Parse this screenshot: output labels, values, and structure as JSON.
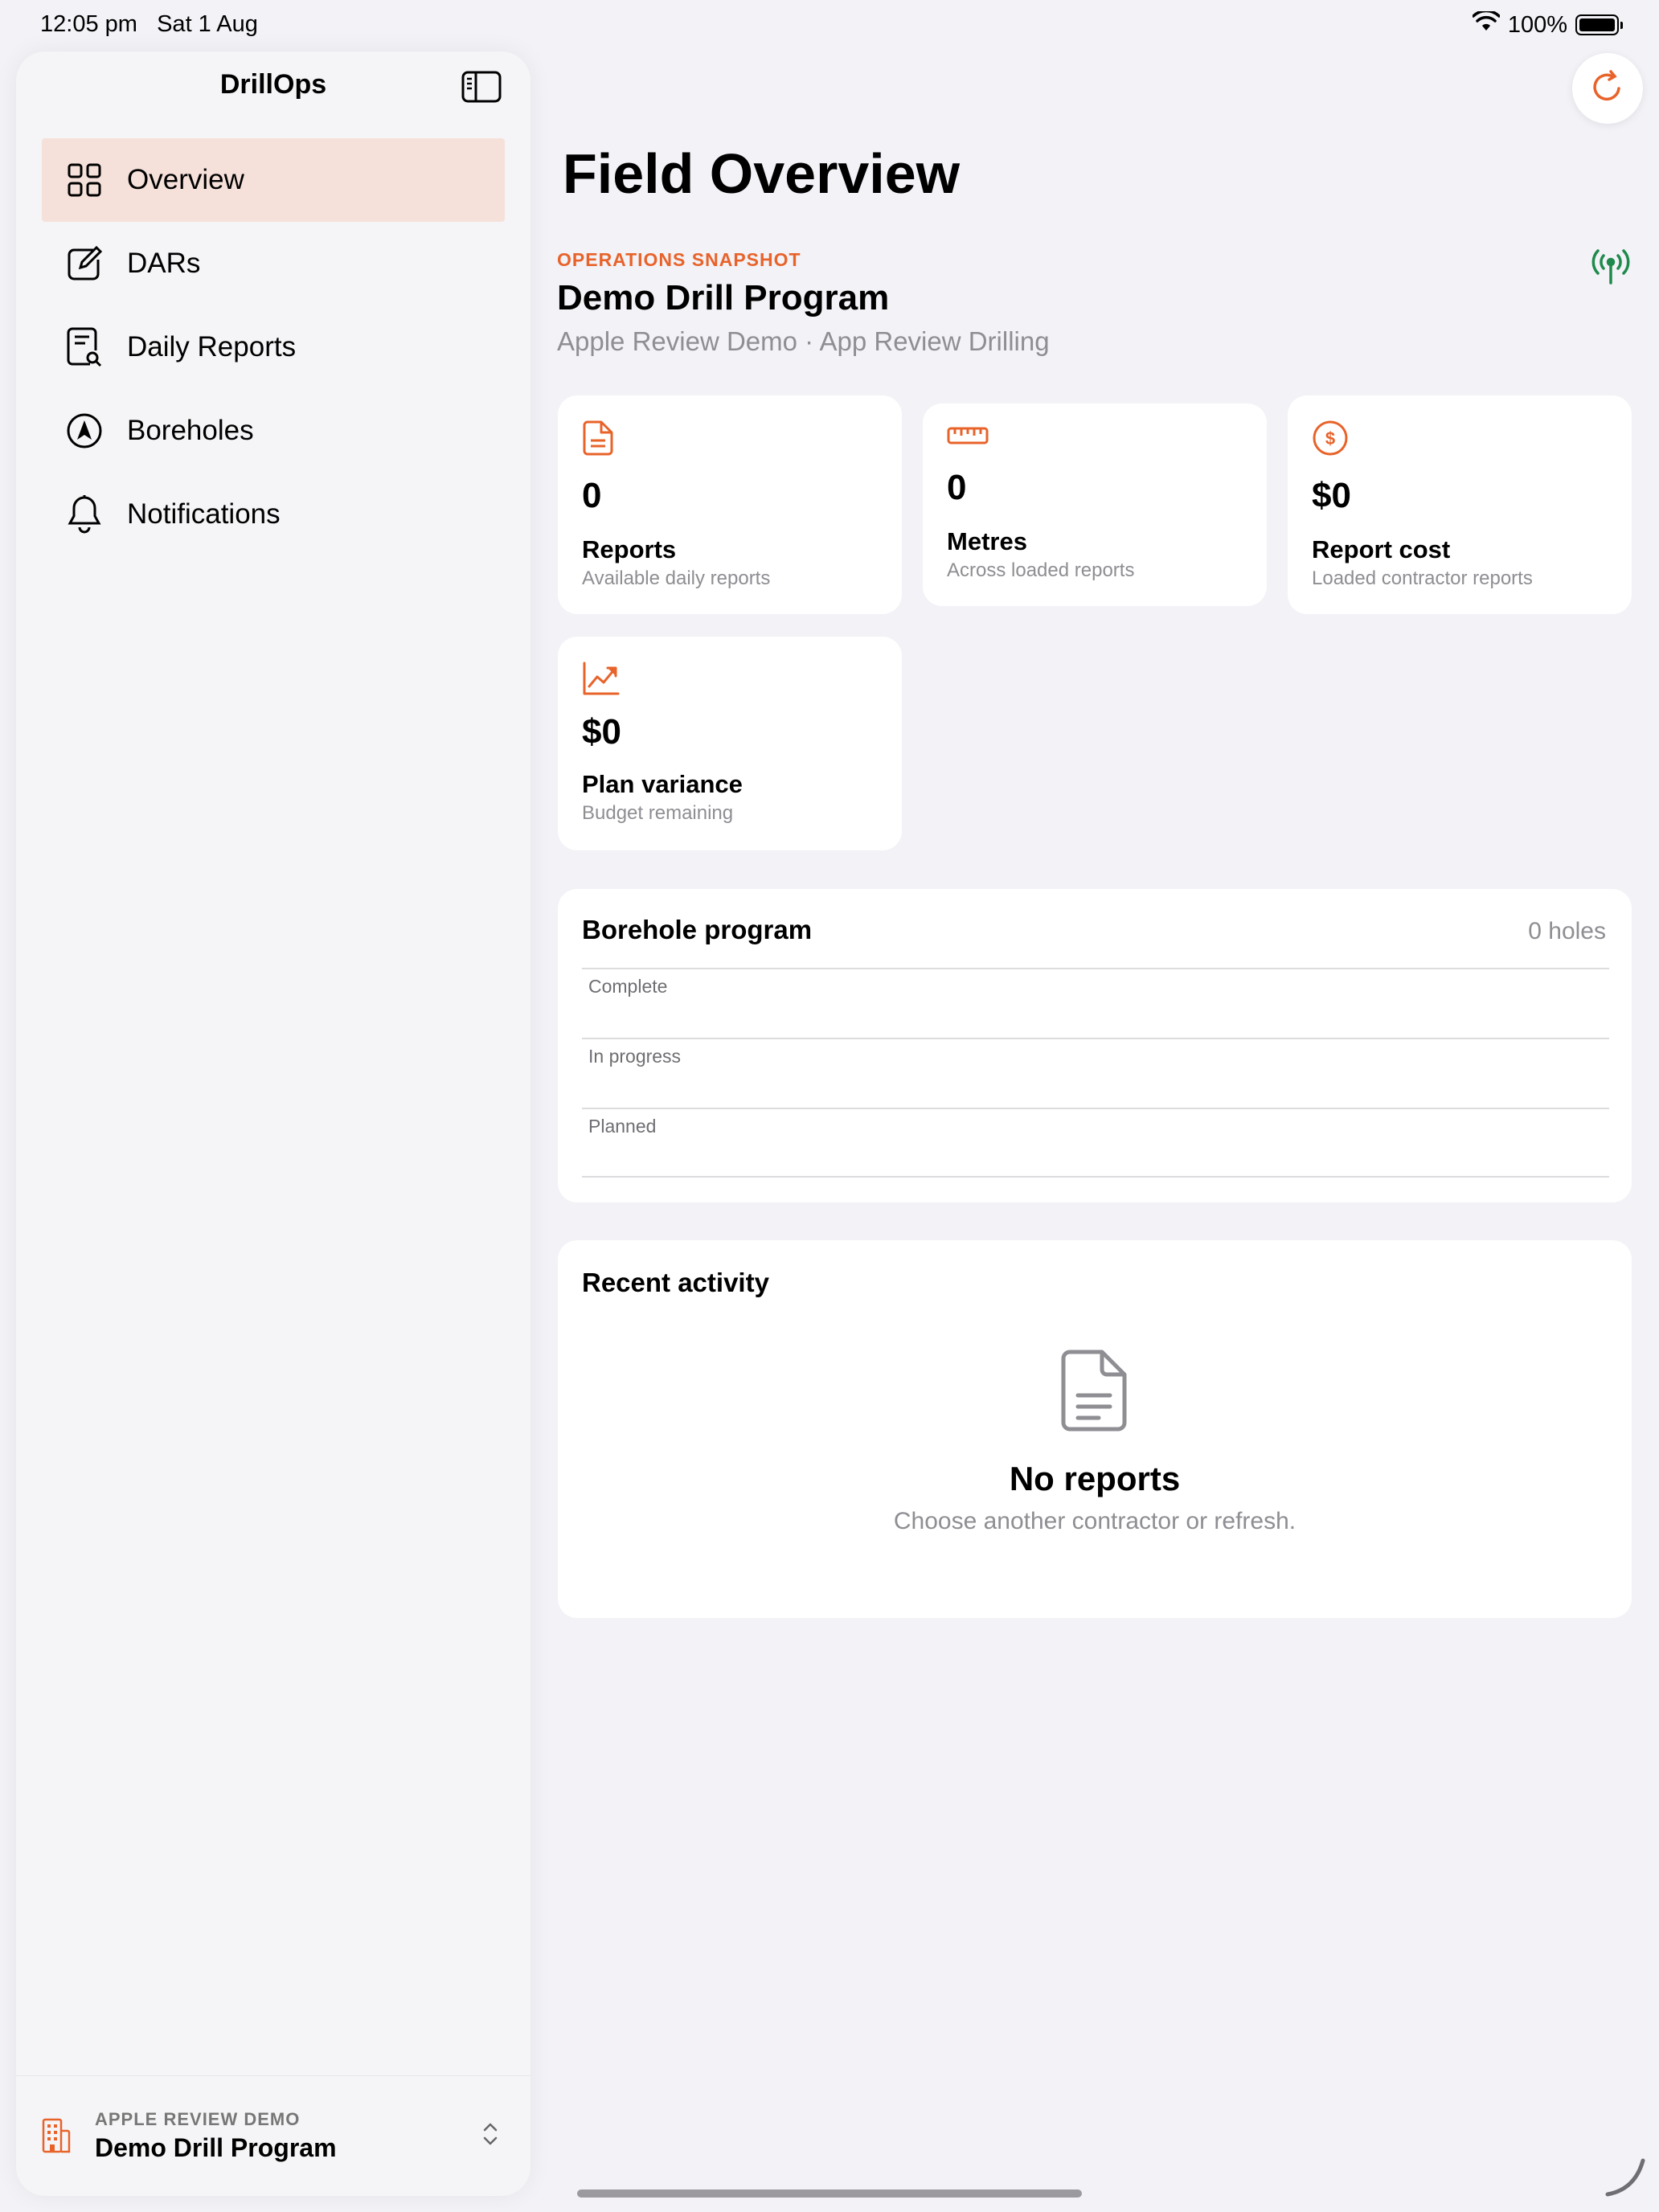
{
  "status_bar": {
    "time": "12:05 pm",
    "date": "Sat 1 Aug",
    "battery_text": "100%",
    "icons": [
      "wifi-icon",
      "battery-icon"
    ]
  },
  "sidebar": {
    "title": "DrillOps",
    "toggle_icon": "sidebar-toggle-icon",
    "items": [
      {
        "label": "Overview",
        "icon": "grid-icon",
        "active": true
      },
      {
        "label": "DARs",
        "icon": "compose-icon",
        "active": false
      },
      {
        "label": "Daily Reports",
        "icon": "document-search-icon",
        "active": false
      },
      {
        "label": "Boreholes",
        "icon": "location-arrow-icon",
        "active": false
      },
      {
        "label": "Notifications",
        "icon": "bell-icon",
        "active": false
      }
    ],
    "footer": {
      "subtitle": "APPLE REVIEW DEMO",
      "title": "Demo Drill Program",
      "icon": "building-icon"
    }
  },
  "main": {
    "page_title": "Field Overview",
    "snapshot_label": "OPERATIONS SNAPSHOT",
    "program_title": "Demo Drill Program",
    "program_subtitle": "Apple Review Demo · App Review Drilling",
    "stats": [
      {
        "value": "0",
        "label": "Reports",
        "desc": "Available daily reports",
        "icon": "document-icon"
      },
      {
        "value": "0",
        "label": "Metres",
        "desc": "Across loaded reports",
        "icon": "ruler-icon"
      },
      {
        "value": "$0",
        "label": "Report cost",
        "desc": "Loaded contractor reports",
        "icon": "dollar-icon"
      },
      {
        "value": "$0",
        "label": "Plan variance",
        "desc": "Budget remaining",
        "icon": "chart-up-icon"
      }
    ],
    "borehole_program": {
      "title": "Borehole program",
      "count": "0 holes",
      "rows": [
        "Complete",
        "In progress",
        "Planned"
      ]
    },
    "recent_activity": {
      "title": "Recent activity",
      "empty_title": "No reports",
      "empty_subtitle": "Choose another contractor or refresh."
    }
  },
  "colors": {
    "accent": "#e8632a",
    "active_bg": "#f6e1da",
    "signal_green": "#1f8a4c",
    "background": "#f2f2f7"
  }
}
